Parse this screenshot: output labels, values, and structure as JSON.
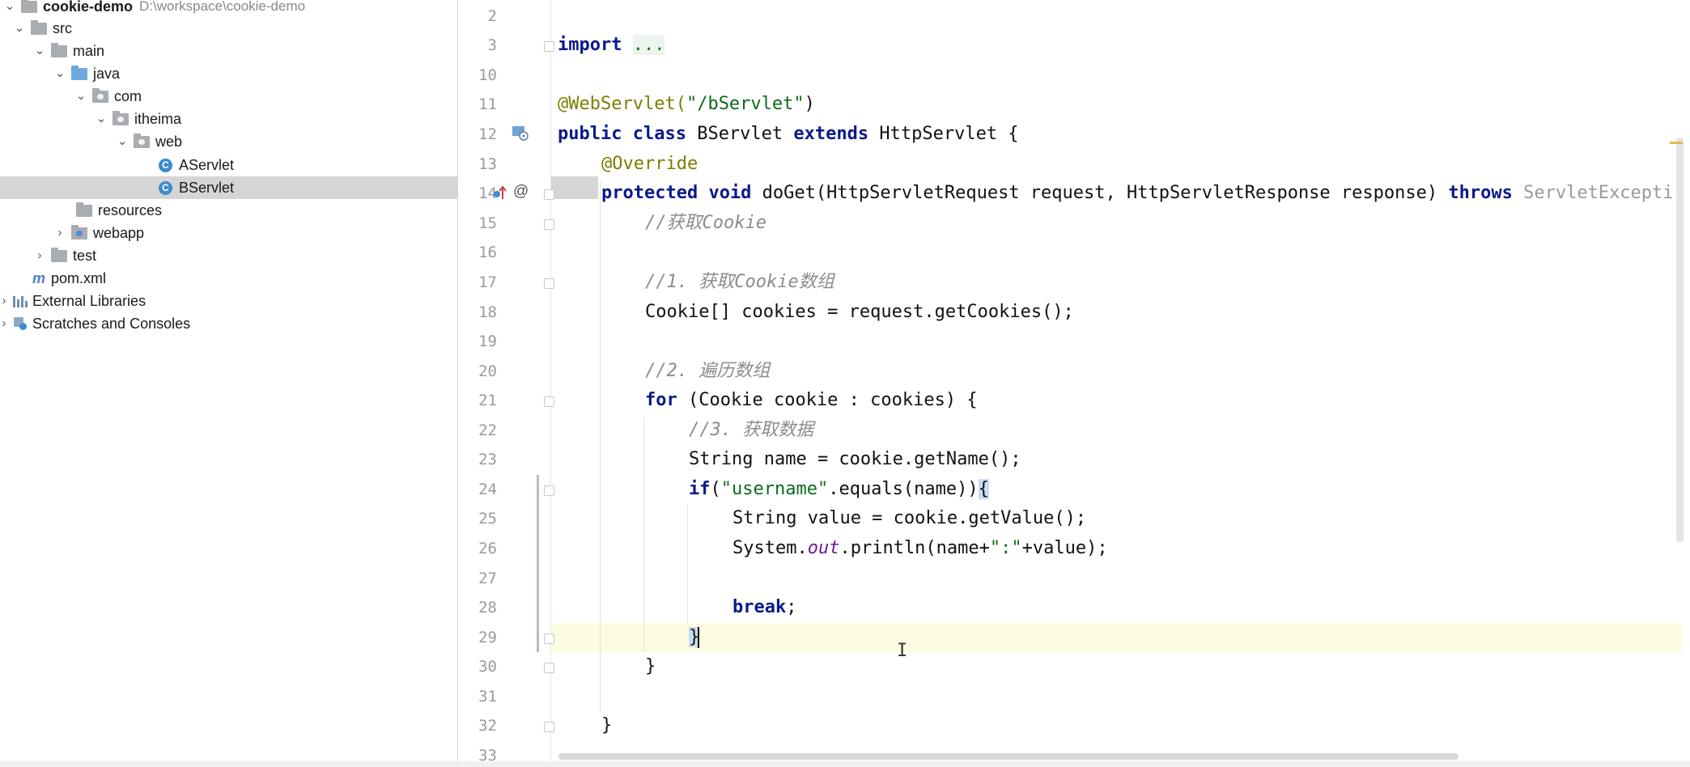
{
  "project_tree": {
    "root_name": "cookie-demo",
    "root_path": "D:\\workspace\\cookie-demo",
    "items": [
      {
        "label": "src"
      },
      {
        "label": "main"
      },
      {
        "label": "java"
      },
      {
        "label": "com"
      },
      {
        "label": "itheima"
      },
      {
        "label": "web"
      },
      {
        "label": "AServlet"
      },
      {
        "label": "BServlet"
      },
      {
        "label": "resources"
      },
      {
        "label": "webapp"
      },
      {
        "label": "test"
      },
      {
        "label": "pom.xml"
      },
      {
        "label": "External Libraries"
      },
      {
        "label": "Scratches and Consoles"
      }
    ]
  },
  "line_numbers": [
    "2",
    "3",
    "10",
    "11",
    "12",
    "13",
    "14",
    "15",
    "16",
    "17",
    "18",
    "19",
    "20",
    "21",
    "22",
    "23",
    "24",
    "25",
    "26",
    "27",
    "28",
    "29",
    "30",
    "31",
    "32",
    "33"
  ],
  "code": {
    "l3_import": "import",
    "l3_dots": "...",
    "l11_annotation": "@WebServlet(",
    "l11_string": "\"/bServlet\"",
    "l11_close": ")",
    "l12_kw1": "public class",
    "l12_name": " BServlet ",
    "l12_kw2": "extends",
    "l12_rest": " HttpServlet {",
    "l13_override": "@Override",
    "l14_kw": "protected void",
    "l14_sig": " doGet(HttpServletRequest request, HttpServletResponse response) ",
    "l14_throws": "throws",
    "l14_exc": " ServletExcepti",
    "l15_comment": "//获取Cookie",
    "l17_comment": "//1. 获取Cookie数组",
    "l18_code": "Cookie[] cookies = request.getCookies();",
    "l20_comment": "//2. 遍历数组",
    "l21_for": "for",
    "l21_rest": " (Cookie cookie : cookies) {",
    "l22_comment": "//3. 获取数据",
    "l23_code": "String name = cookie.getName();",
    "l24_if": "if",
    "l24_paren": "(",
    "l24_string": "\"username\"",
    "l24_rest": ".equals(name))",
    "l24_brace": "{",
    "l25_code": "String value = cookie.getValue();",
    "l26_sys": "System.",
    "l26_out": "out",
    "l26_println": ".println(name+",
    "l26_string": "\":\"",
    "l26_end": "+value);",
    "l28_break": "break",
    "l28_semi": ";",
    "l29_brace": "}",
    "l30_brace": "}",
    "l32_brace": "}"
  }
}
